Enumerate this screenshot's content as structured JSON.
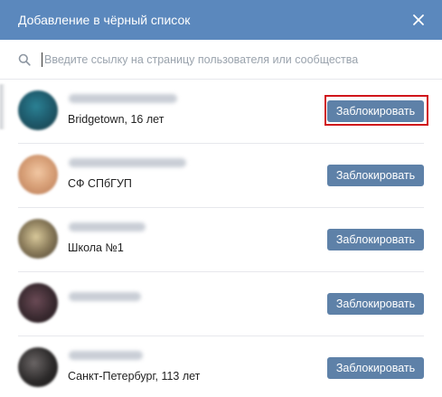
{
  "dialog": {
    "title": "Добавление в чёрный список",
    "close_icon": "close-icon"
  },
  "search": {
    "placeholder": "Введите ссылку на страницу пользователя или сообщества",
    "value": "",
    "icon": "search-icon"
  },
  "colors": {
    "header_bg": "#5b88bd",
    "button_bg": "#5e81a8",
    "highlight_border": "#d0151b"
  },
  "rows": [
    {
      "subtitle": "Bridgetown, 16 лет",
      "button_label": "Заблокировать",
      "highlighted": true,
      "avatar_color": "#1f5e70"
    },
    {
      "subtitle": "СФ СПбГУП",
      "button_label": "Заблокировать",
      "highlighted": false,
      "avatar_color": "#d9a27a"
    },
    {
      "subtitle": "Школа №1",
      "button_label": "Заблокировать",
      "highlighted": false,
      "avatar_color": "#8a7b5a"
    },
    {
      "subtitle": "",
      "button_label": "Заблокировать",
      "highlighted": false,
      "avatar_color": "#3a2a30"
    },
    {
      "subtitle": "Санкт-Петербург, 113 лет",
      "button_label": "Заблокировать",
      "highlighted": false,
      "avatar_color": "#2c2a2a"
    }
  ]
}
